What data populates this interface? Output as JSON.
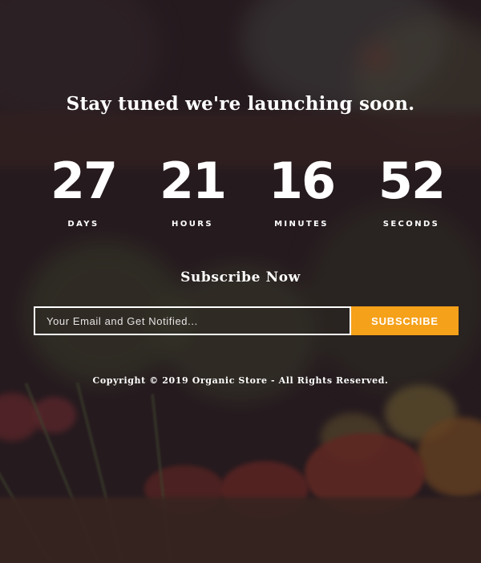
{
  "headline": "Stay tuned we're launching soon.",
  "countdown": [
    {
      "value": "27",
      "label": "DAYS"
    },
    {
      "value": "21",
      "label": "HOURS"
    },
    {
      "value": "16",
      "label": "MINUTES"
    },
    {
      "value": "52",
      "label": "SECONDS"
    }
  ],
  "subscribe": {
    "title": "Subscribe Now",
    "email_placeholder": "Your Email and Get Notified...",
    "email_value": "",
    "button_label": "SUBSCRIBE"
  },
  "footer": {
    "copyright": "Copyright © 2019 Organic Store - All Rights Reserved."
  },
  "colors": {
    "accent": "#f5a11a",
    "overlay": "#22161c",
    "text": "#ffffff"
  }
}
